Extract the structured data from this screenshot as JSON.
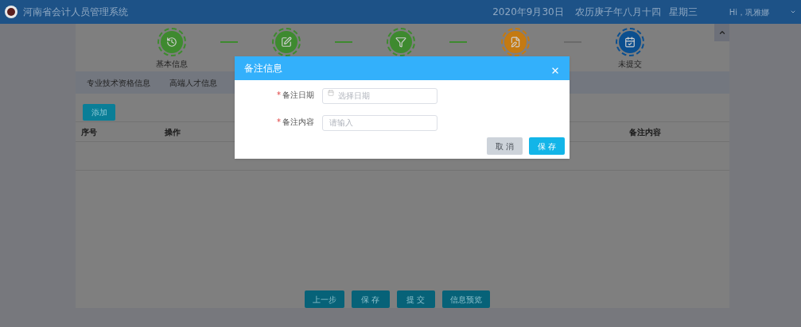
{
  "header": {
    "title": "河南省会计人员管理系统",
    "date": "2020年9月30日",
    "lunar": "农历庚子年八月十四",
    "weekday": "星期三",
    "greeting": "Hi，巩雅娜"
  },
  "steps": [
    {
      "label": "基本信息",
      "color": "#3e8a2f"
    },
    {
      "color": "#3e8a2f"
    },
    {
      "color": "#3e8a2f"
    },
    {
      "color": "#c47a12"
    },
    {
      "label": "未提交",
      "color": "#0b4f8f"
    }
  ],
  "connectors": [
    {
      "done": true
    },
    {
      "done": true
    },
    {
      "done": true
    },
    {
      "done": false
    }
  ],
  "tabs": [
    "专业技术资格信息",
    "高端人才信息"
  ],
  "add_button": "添加",
  "table": {
    "columns": [
      "序号",
      "操作",
      "备注内容"
    ]
  },
  "footer_buttons": [
    "上一步",
    "保 存",
    "提 交",
    "信息预览"
  ],
  "dialog": {
    "title": "备注信息",
    "fields": [
      {
        "label": "备注日期",
        "required_mark": "*",
        "placeholder": "选择日期",
        "kind": "date"
      },
      {
        "label": "备注内容",
        "required_mark": "*",
        "placeholder": "请输入",
        "kind": "text"
      }
    ],
    "buttons": [
      {
        "label": "取 消",
        "kind": "secondary"
      },
      {
        "label": "保 存",
        "kind": "primary"
      }
    ]
  }
}
